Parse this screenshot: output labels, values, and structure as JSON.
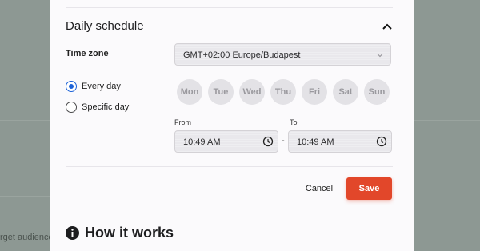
{
  "background": {
    "partial_text": "rget audience"
  },
  "schedule": {
    "title": "Daily schedule",
    "timezone_label": "Time zone",
    "timezone_value": "GMT+02:00 Europe/Budapest",
    "radio_options": [
      {
        "label": "Every day",
        "checked": true
      },
      {
        "label": "Specific day",
        "checked": false
      }
    ],
    "days": [
      "Mon",
      "Tue",
      "Wed",
      "Thu",
      "Fri",
      "Sat",
      "Sun"
    ],
    "from_label": "From",
    "from_value": "10:49 AM",
    "to_label": "To",
    "to_value": "10:49 AM",
    "separator": "-"
  },
  "actions": {
    "cancel_label": "Cancel",
    "save_label": "Save"
  },
  "how_it_works": {
    "title": "How it works"
  },
  "colors": {
    "accent_primary": "#1c62d8",
    "save_button": "#e2472a"
  },
  "icons": {
    "collapse": "chevron-up-icon",
    "select": "chevron-down-icon",
    "time": "clock-icon",
    "info": "info-icon"
  }
}
